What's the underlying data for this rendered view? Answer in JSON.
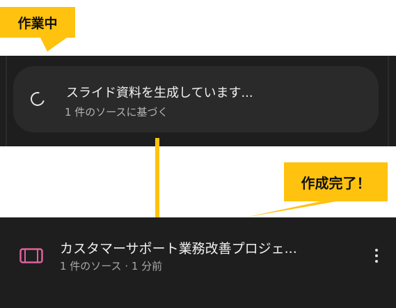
{
  "callouts": {
    "working": "作業中",
    "done": "作成完了！"
  },
  "generating_card": {
    "title": "スライド資料を生成しています...",
    "subtitle": "1 件のソースに基づく",
    "icon": "loading-spinner-icon"
  },
  "result_item": {
    "title": "カスタマーサポート業務改善プロジェ...",
    "meta": "1 件のソース · 1 分前",
    "icon": "slides-icon",
    "menu_icon": "more-vert-icon"
  },
  "colors": {
    "accent": "#ffc20e",
    "panel": "#1e1e1e",
    "card": "#2a2a2a",
    "slides_icon": "#e0619a"
  }
}
